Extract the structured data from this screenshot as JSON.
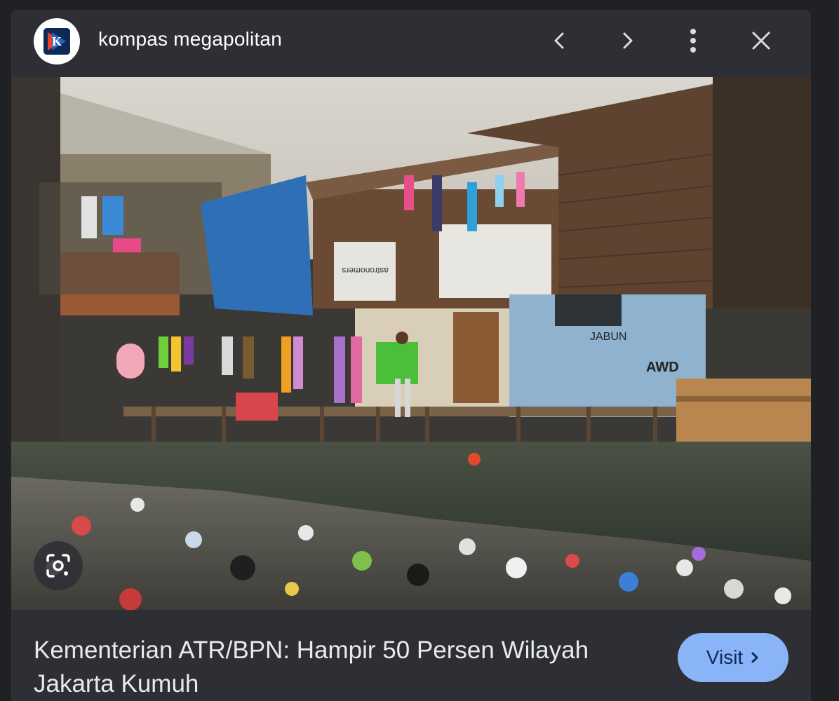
{
  "header": {
    "source_name": "kompas megapolitan",
    "logo_letter": "K",
    "icons": {
      "back": "chevron-left-icon",
      "forward": "chevron-right-icon",
      "more": "more-vert-icon",
      "close": "close-icon"
    }
  },
  "image": {
    "sign_text": "astronomers",
    "graffiti": [
      "JABUN",
      "AWD"
    ],
    "lens_icon": "google-lens-icon"
  },
  "footer": {
    "headline": "Kementerian ATR/BPN: Hampir 50 Persen Wilayah Jakarta Kumuh",
    "visit_label": "Visit"
  },
  "colors": {
    "background": "#1f2125",
    "panel": "#2d2f34",
    "accent": "#8ab4f8",
    "text": "#e8eaed"
  }
}
